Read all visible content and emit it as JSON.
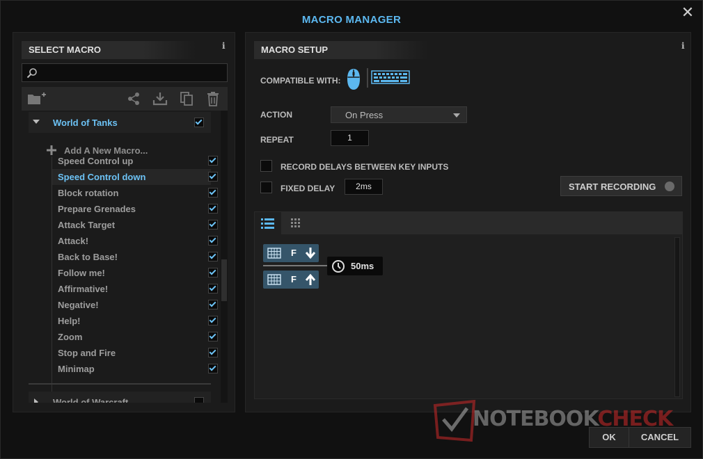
{
  "window": {
    "title": "MACRO MANAGER",
    "close_glyph": "✕"
  },
  "left_panel": {
    "header": "SELECT MACRO",
    "info_glyph": "i",
    "search": {
      "value": "",
      "placeholder": ""
    },
    "toolbar_icons": [
      "new-folder-icon",
      "share-icon",
      "import-icon",
      "copy-icon",
      "delete-icon"
    ],
    "groups": [
      {
        "name": "World of Tanks",
        "expanded": true,
        "checked": true,
        "add_label": "Add A New Macro...",
        "items": [
          {
            "label": "Speed Control up",
            "checked": true,
            "selected": false
          },
          {
            "label": "Speed Control down",
            "checked": true,
            "selected": true
          },
          {
            "label": "Block rotation",
            "checked": true,
            "selected": false
          },
          {
            "label": "Prepare Grenades",
            "checked": true,
            "selected": false
          },
          {
            "label": "Attack Target",
            "checked": true,
            "selected": false
          },
          {
            "label": "Attack!",
            "checked": true,
            "selected": false
          },
          {
            "label": "Back to Base!",
            "checked": true,
            "selected": false
          },
          {
            "label": "Follow me!",
            "checked": true,
            "selected": false
          },
          {
            "label": "Affirmative!",
            "checked": true,
            "selected": false
          },
          {
            "label": "Negative!",
            "checked": true,
            "selected": false
          },
          {
            "label": "Help!",
            "checked": true,
            "selected": false
          },
          {
            "label": "Zoom",
            "checked": true,
            "selected": false
          },
          {
            "label": "Stop and Fire",
            "checked": true,
            "selected": false
          },
          {
            "label": "Minimap",
            "checked": true,
            "selected": false
          }
        ]
      },
      {
        "name": "World of Warcraft",
        "expanded": false,
        "checked": false
      }
    ]
  },
  "right_panel": {
    "header": "MACRO SETUP",
    "info_glyph": "i",
    "compatible_label": "COMPATIBLE WITH:",
    "action_label": "ACTION",
    "action_value": "On Press",
    "repeat_label": "REPEAT",
    "repeat_value": "1",
    "record_delays_label": "RECORD DELAYS BETWEEN KEY INPUTS",
    "fixed_delay_label": "FIXED DELAY",
    "fixed_delay_value": "2ms",
    "start_recording_label": "START RECORDING",
    "events": [
      {
        "device": "keyboard-icon",
        "key": "F",
        "direction": "down"
      },
      {
        "device": "keyboard-icon",
        "key": "F",
        "direction": "up"
      }
    ],
    "delay_value": "50ms"
  },
  "footer": {
    "ok_label": "OK",
    "cancel_label": "CANCEL"
  },
  "watermark": {
    "part1": "NOTEBOOK",
    "part2": "CHECK"
  },
  "colors": {
    "accent": "#5cb8f0",
    "chip": "#35556a"
  }
}
